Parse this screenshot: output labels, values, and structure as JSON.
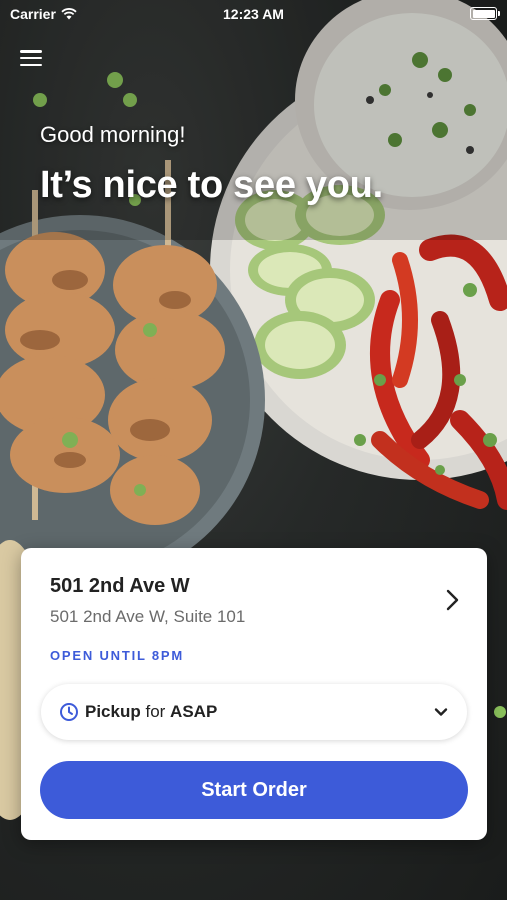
{
  "status_bar": {
    "carrier": "Carrier",
    "time": "12:23 AM",
    "icons": [
      "wifi-icon",
      "battery-icon"
    ]
  },
  "header": {
    "menu_icon": "hamburger-menu-icon",
    "greeting_small": "Good morning!",
    "greeting_large": "It’s nice to see you."
  },
  "location_card": {
    "store_name": "501 2nd Ave W",
    "store_address": "501 2nd Ave W, Suite 101",
    "open_hours": "OPEN UNTIL 8PM",
    "chevron_icon": "chevron-right-icon",
    "order_mode": {
      "mode_label": "Pickup",
      "connector": " for ",
      "time_label": "ASAP",
      "clock_icon": "clock-icon",
      "dropdown_icon": "chevron-down-icon"
    },
    "start_button_label": "Start Order"
  },
  "colors": {
    "accent": "#3d5bd9",
    "card_background": "#ffffff",
    "text_primary": "#222222",
    "text_secondary": "#6b6b6b"
  }
}
